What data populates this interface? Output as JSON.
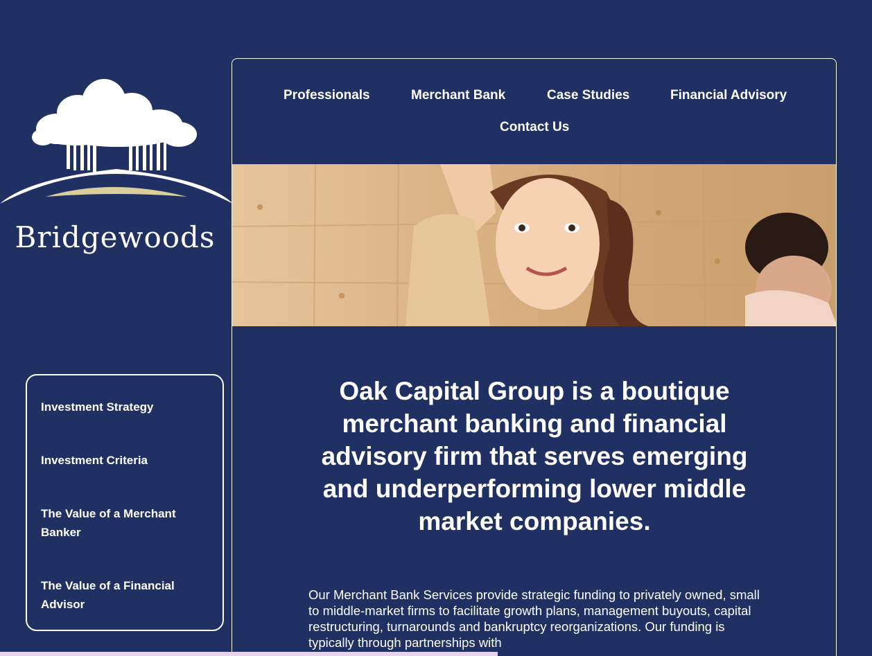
{
  "brand": {
    "name": "Bridgewoods",
    "logo_icon": "tree-on-hill-icon"
  },
  "nav": {
    "items": [
      {
        "label": "Professionals"
      },
      {
        "label": "Merchant Bank"
      },
      {
        "label": "Case Studies"
      },
      {
        "label": "Financial Advisory"
      },
      {
        "label": "Contact Us"
      }
    ]
  },
  "sidebar": {
    "items": [
      {
        "label": "Investment Strategy"
      },
      {
        "label": "Investment Criteria"
      },
      {
        "label": "The Value of a Merchant Banker"
      },
      {
        "label": "The Value of a Financial Advisor"
      }
    ]
  },
  "hero": {
    "image": "children-in-classroom-photo"
  },
  "main": {
    "headline": "Oak Capital Group is a boutique merchant banking and financial advisory firm that serves emerging and underperforming lower middle market companies.",
    "body": "Our Merchant Bank Services provide strategic funding to privately owned, small to middle-market firms to facilitate growth plans, management buyouts, capital restructuring, turnarounds and bankruptcy reorganizations. Our funding is typically through partnerships with"
  },
  "colors": {
    "background": "#213063",
    "text": "#ffffff",
    "accent_hill": "#d8cf9c"
  }
}
